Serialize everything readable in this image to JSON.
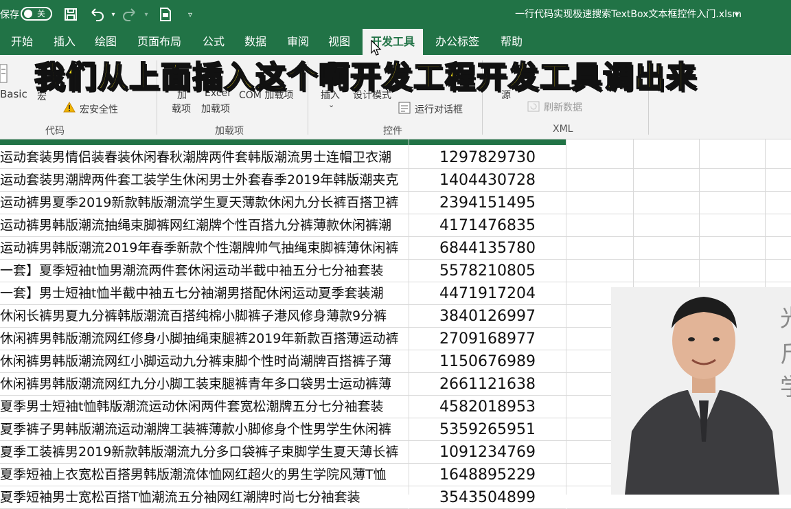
{
  "titlebar": {
    "autosave_label": "保存",
    "autosave_state": "关",
    "doc_title": "一行代码实现极速搜索TextBox文本框控件入门.xlsm",
    "title_dropdown": "▾",
    "icons": [
      "save-icon",
      "undo-icon",
      "redo-icon",
      "macro-icon",
      "customize-icon"
    ]
  },
  "tabs": [
    "开始",
    "插入",
    "绘图",
    "页面布局",
    "公式",
    "数据",
    "审阅",
    "视图",
    "开发工具",
    "办公标签",
    "帮助"
  ],
  "active_tab": "开发工具",
  "ribbon": {
    "code": {
      "basic": "Basic",
      "macro": "宏",
      "macro_security": "宏安全性",
      "group": "代码"
    },
    "addins": {
      "addins_a": "加",
      "addins_b": "载项",
      "excel_a": "Excel",
      "excel_b": "加载项",
      "com": "COM 加载项",
      "group": "加载项"
    },
    "controls": {
      "insert": "插入",
      "design_mode": "设计模式",
      "run_dialog": "运行对话框",
      "group": "控件"
    },
    "xml": {
      "source": "源",
      "refresh": "刷新数据",
      "group": "XML"
    }
  },
  "caption": "我们从上面插入这个啊开发工程开发工具调出来",
  "rows": [
    {
      "name": "运动套装男情侣装春装休闲春秋潮牌两件套韩版潮流男士连帽卫衣潮",
      "id": "1297829730"
    },
    {
      "name": "运动套装男潮牌两件套工装学生休闲男士外套春季2019年韩版潮夹克",
      "id": "1404430728"
    },
    {
      "name": "运动裤男夏季2019新款韩版潮流学生夏天薄款休闲九分长裤百搭卫裤",
      "id": "2394151495"
    },
    {
      "name": "运动裤男韩版潮流抽绳束脚裤网红潮牌个性百搭九分裤薄款休闲裤潮",
      "id": "4171476835"
    },
    {
      "name": "运动裤男韩版潮流2019年春季新款个性潮牌帅气抽绳束脚裤薄休闲裤",
      "id": "6844135780"
    },
    {
      "name": "一套】夏季短袖t恤男潮流两件套休闲运动半截中袖五分七分袖套装",
      "id": "5578210805"
    },
    {
      "name": "一套】男士短袖t恤半截中袖五七分袖潮男搭配休闲运动夏季套装潮",
      "id": "4471917204"
    },
    {
      "name": "休闲长裤男夏九分裤韩版潮流百搭纯棉小脚裤子港风修身薄款9分裤",
      "id": "3840126997"
    },
    {
      "name": "休闲裤男韩版潮流网红修身小脚抽绳束腿裤2019年新款百搭薄运动裤",
      "id": "2709168977"
    },
    {
      "name": "休闲裤男韩版潮流网红小脚运动九分裤束脚个性时尚潮牌百搭裤子薄",
      "id": "1150676989"
    },
    {
      "name": "休闲裤男韩版潮流网红九分小脚工装束腿裤青年多口袋男士运动裤薄",
      "id": "2661121638"
    },
    {
      "name": "夏季男士短袖t恤韩版潮流运动休闲两件套宽松潮牌五分七分袖套装",
      "id": "4582018953"
    },
    {
      "name": "夏季裤子男韩版潮流运动潮牌工装裤薄款小脚修身个性男学生休闲裤",
      "id": "5359265951"
    },
    {
      "name": "夏季工装裤男2019新款韩版潮流九分多口袋裤子束脚学生夏天薄长裤",
      "id": "1091234769"
    },
    {
      "name": "夏季短袖上衣宽松百搭男韩版潮流体恤网红超火的男生学院风薄T恤",
      "id": "1648895229"
    },
    {
      "name": "夏季短袖男士宽松百搭T恤潮流五分袖网红潮牌时尚七分袖套装",
      "id": "3543504899"
    }
  ],
  "presenter_text": [
    "光",
    "斤",
    "学"
  ],
  "colors": {
    "accent": "#217346",
    "caption": "#ffe81a"
  }
}
